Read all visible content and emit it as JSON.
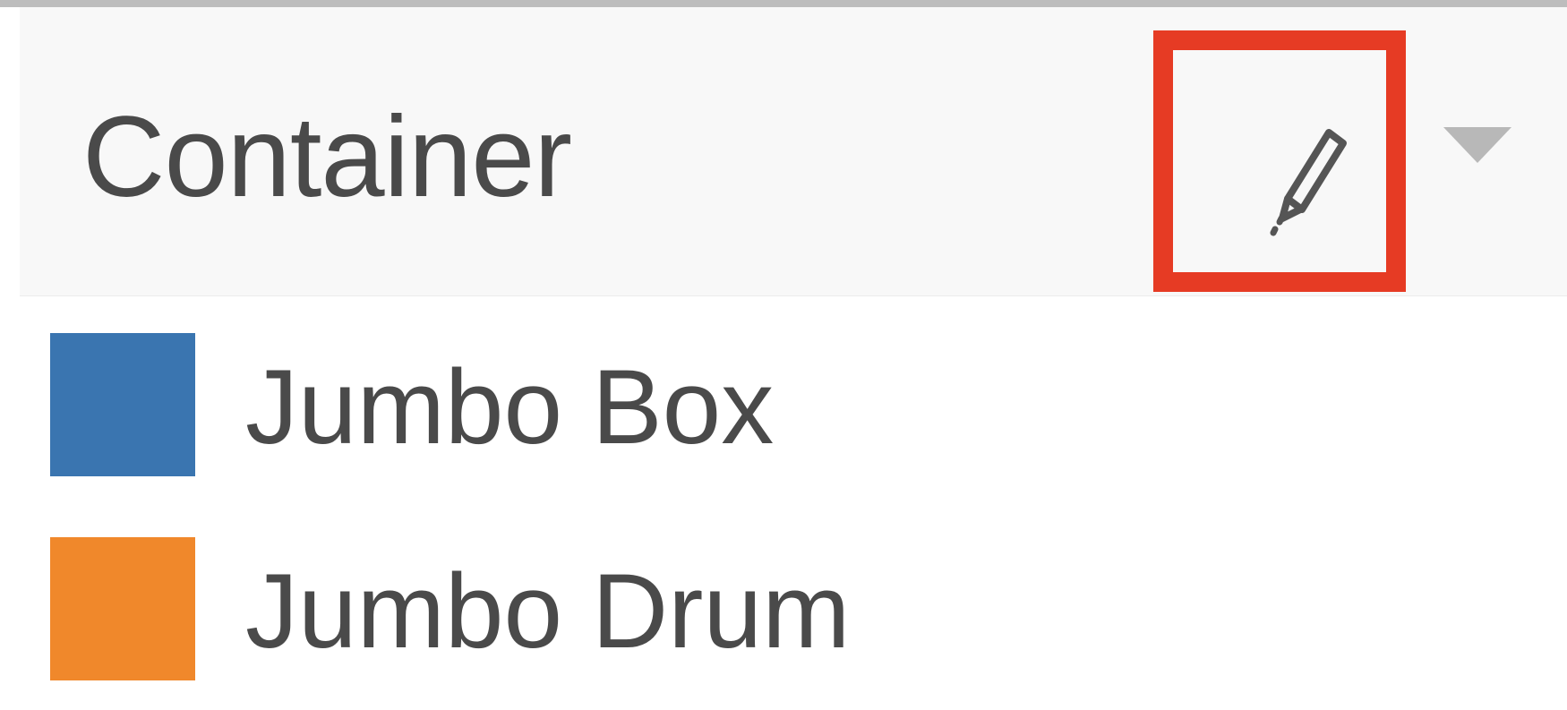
{
  "header": {
    "title": "Container",
    "edit_icon": "pencil-icon",
    "dropdown_icon": "caret-down-icon"
  },
  "legend": {
    "items": [
      {
        "label": "Jumbo Box",
        "color": "#3a75b0"
      },
      {
        "label": "Jumbo Drum",
        "color": "#f0882b"
      }
    ]
  },
  "colors": {
    "highlight": "#e63b24",
    "header_bg": "#f8f8f8",
    "text": "#4a4a4a"
  }
}
